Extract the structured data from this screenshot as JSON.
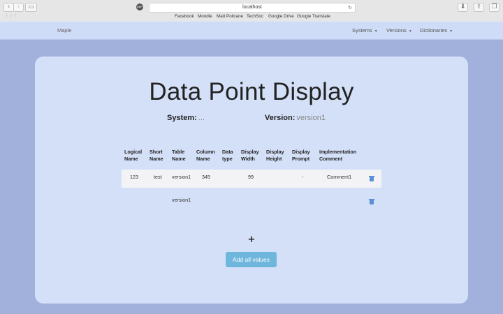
{
  "browser": {
    "url": "localhost",
    "bookmarks": [
      "Facebook",
      "Moodle",
      "Matt Policane",
      "TechSoc",
      "Google Drive",
      "Google Translate"
    ]
  },
  "nav": {
    "brand": "Maple",
    "items": [
      "Systems",
      "Versions",
      "Dictionaries"
    ]
  },
  "page": {
    "title": "Data Point Display",
    "system_label": "System:",
    "system_value": "...",
    "version_label": "Version:",
    "version_value": "version1"
  },
  "table": {
    "headers": [
      [
        "Logical",
        "Name"
      ],
      [
        "Short",
        "Name"
      ],
      [
        "Table",
        "Name"
      ],
      [
        "Column",
        "Name"
      ],
      [
        "Data",
        "type"
      ],
      [
        "Display",
        "Width"
      ],
      [
        "Display",
        "Height"
      ],
      [
        "Display",
        "Prompt"
      ],
      [
        "Implementation",
        "Comment"
      ]
    ],
    "rows": [
      {
        "logical": "123",
        "short": "test",
        "table": "version1",
        "column": "345",
        "dtype": "",
        "width": "99",
        "height": "",
        "prompt": "-",
        "comment": "Comment1"
      },
      {
        "logical": "",
        "short": "",
        "table": "version1",
        "column": "",
        "dtype": "",
        "width": "",
        "height": "",
        "prompt": "",
        "comment": ""
      }
    ]
  },
  "actions": {
    "add_row": "+",
    "add_all": "Add all values"
  },
  "colors": {
    "background": "#a1b1dc",
    "card": "#d4e0f8",
    "navbar": "#cfdcf7",
    "button": "#6fb6dc",
    "trash": "#5b8fd6"
  }
}
